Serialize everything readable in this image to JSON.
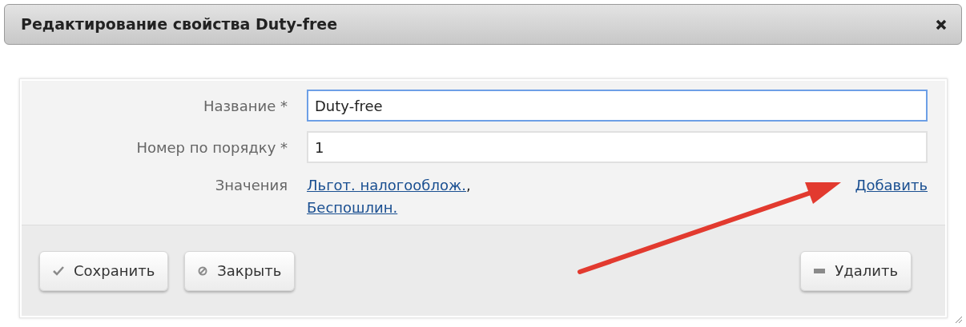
{
  "dialog": {
    "title": "Редактирование свойства Duty-free"
  },
  "fields": [
    {
      "label": "Название *",
      "value": "Duty-free",
      "focused": true
    },
    {
      "label": "Номер по порядку *",
      "value": "1",
      "focused": false
    }
  ],
  "values": {
    "label": "Значения",
    "items": [
      "Льгот. налогооблож.",
      "Беспошлин."
    ],
    "separator": ",",
    "add_link": "Добавить"
  },
  "buttons_left": [
    {
      "label": "Сохранить",
      "kind": "check"
    },
    {
      "label": "Закрыть",
      "kind": "ban"
    }
  ],
  "buttons_right": [
    {
      "label": "Удалить",
      "kind": "minus"
    }
  ]
}
